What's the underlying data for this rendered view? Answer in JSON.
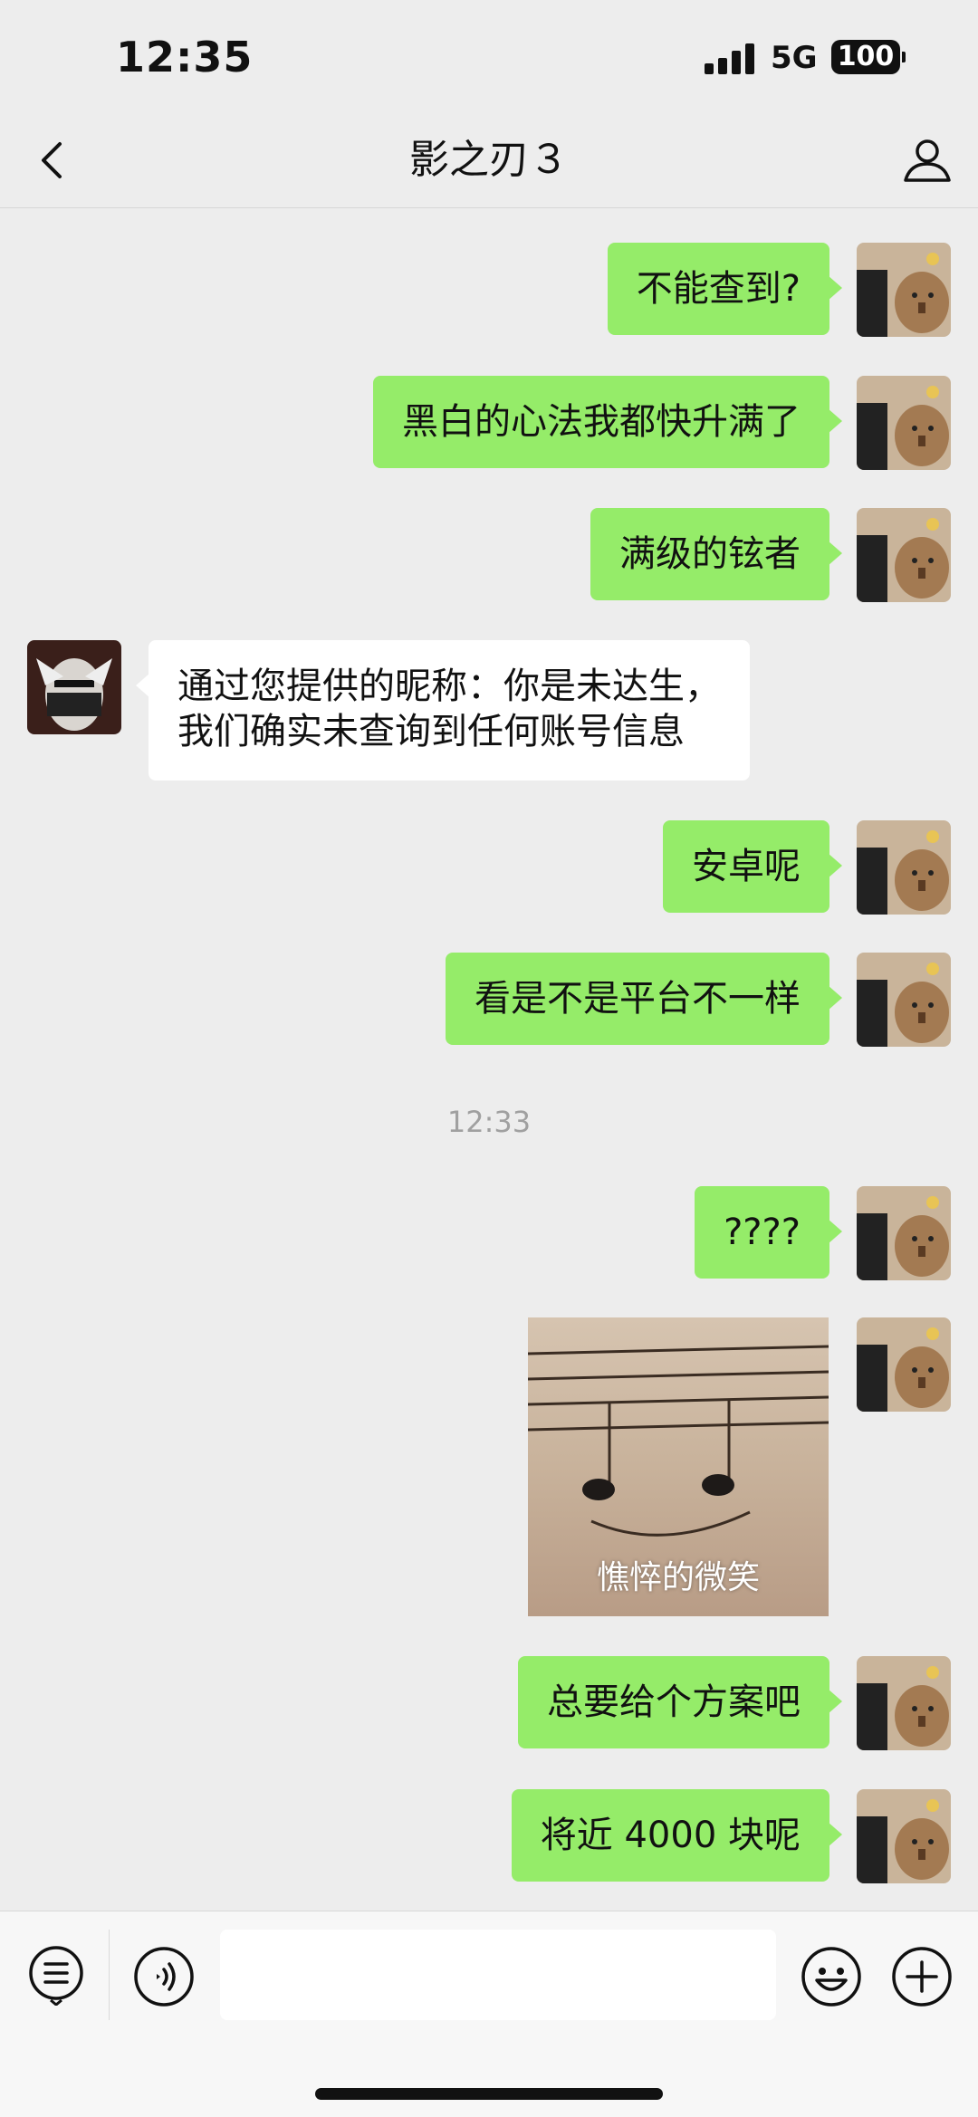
{
  "status_bar": {
    "time": "12:35",
    "network": "5G",
    "battery": "100"
  },
  "header": {
    "title": "影之刃３"
  },
  "messages": [
    {
      "text": "不能查到?"
    },
    {
      "text": "黑白的心法我都快升满了"
    },
    {
      "text": "满级的铉者"
    },
    {
      "line1": "通过您提供的昵称：你是未达生，",
      "line2": "我们确实未查询到任何账号信息"
    },
    {
      "text": "安卓呢"
    },
    {
      "text": "看是不是平台不一样"
    },
    {
      "text": "????"
    },
    {
      "sticker_caption": "憔悴的微笑"
    },
    {
      "text": "总要给个方案吧"
    },
    {
      "text": "将近 4000 块呢"
    }
  ],
  "timestamp": "12:33",
  "icons": {
    "back": "chevron-left-icon",
    "profile": "person-icon",
    "menu": "list-icon",
    "voice": "voice-icon",
    "emoji": "emoji-icon",
    "plus": "plus-icon"
  },
  "colors": {
    "my_bubble": "#95ec69",
    "other_bubble": "#ffffff",
    "background": "#ededed"
  }
}
